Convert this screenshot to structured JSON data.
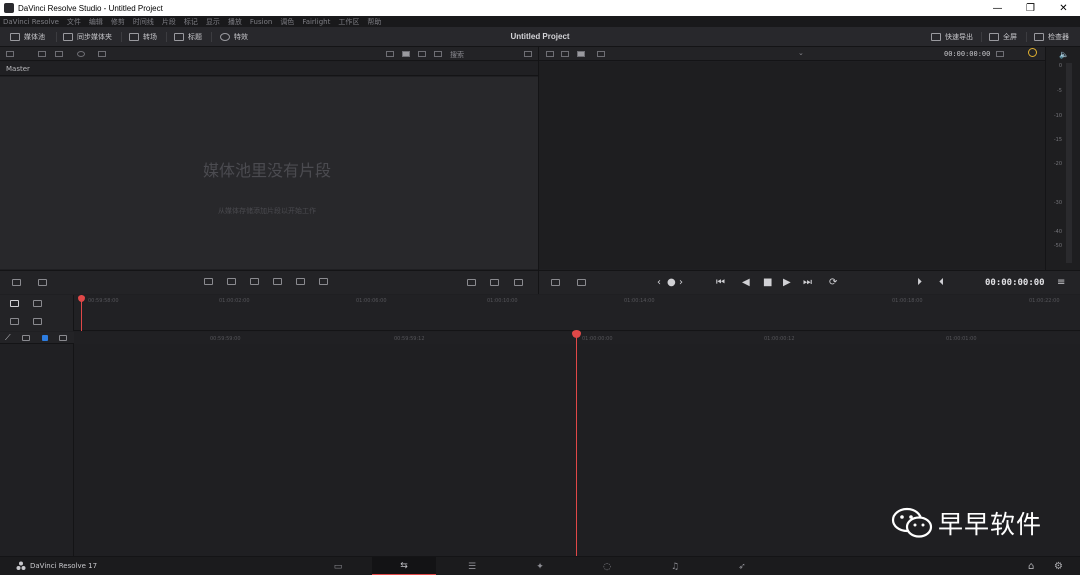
{
  "window": {
    "title": "DaVinci Resolve Studio - Untitled Project",
    "min": "—",
    "restore": "❐",
    "close": "✕"
  },
  "menu": [
    "DaVinci Resolve",
    "文件",
    "编辑",
    "修剪",
    "时间线",
    "片段",
    "标记",
    "显示",
    "播放",
    "Fusion",
    "调色",
    "Fairlight",
    "工作区",
    "帮助"
  ],
  "toolbar": {
    "media_pool": "媒体池",
    "sync_bin": "同步媒体夹",
    "transitions": "转场",
    "titles": "标题",
    "effects": "特效",
    "project_title": "Untitled Project",
    "quick_export": "快速导出",
    "fullscreen": "全屏",
    "inspector": "检查器"
  },
  "media_pool": {
    "search": "搜索",
    "bin_name": "Master",
    "empty_title": "媒体池里没有片段",
    "empty_subtitle": "从媒体存储添加片段以开始工作"
  },
  "viewer": {
    "timecode_top": "00:00:00:00",
    "timecode": "00:00:00:00"
  },
  "meter": {
    "labels": [
      "0",
      "-5",
      "-10",
      "-15",
      "-20",
      "-30",
      "-40",
      "-50"
    ]
  },
  "timeline": {
    "upper_ruler": [
      "00:59:58:00",
      "01:00:02:00",
      "01:00:06:00",
      "01:00:10:00",
      "01:00:14:00",
      "01:00:18:00",
      "01:00:22:00"
    ],
    "lower_ruler": [
      "00:59:59:00",
      "00:59:59:12",
      "01:00:00:00",
      "01:00:00:12",
      "01:00:01:00"
    ]
  },
  "page_bar": {
    "brand": "DaVinci Resolve 17",
    "tabs": [
      "media-page",
      "cut-page",
      "edit-page",
      "fusion-page",
      "color-page",
      "fairlight-page",
      "deliver-page"
    ],
    "active_tab": "cut-page"
  },
  "watermark": {
    "text": "早早软件"
  },
  "colors": {
    "accent": "#e04848",
    "panel": "#28282b",
    "background": "#1f1f22"
  }
}
